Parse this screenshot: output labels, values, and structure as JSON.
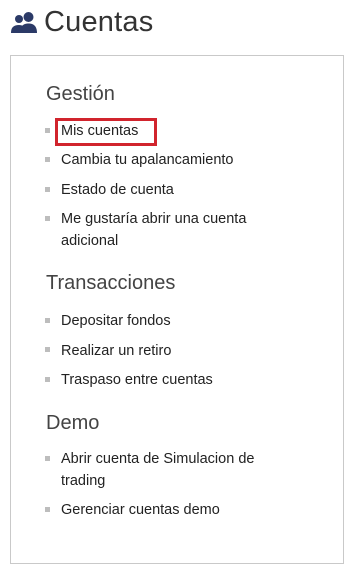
{
  "header": {
    "title": "Cuentas",
    "icon": "users-icon"
  },
  "sections": [
    {
      "title": "Gestión",
      "items": [
        "Mis cuentas",
        "Cambia tu apalancamiento",
        "Estado de cuenta",
        "Me gustaría abrir una cuenta adicional"
      ]
    },
    {
      "title": "Transacciones",
      "items": [
        "Depositar fondos",
        "Realizar un retiro",
        "Traspaso entre cuentas"
      ]
    },
    {
      "title": "Demo",
      "items": [
        "Abrir cuenta de Simulacion de trading",
        "Gerenciar cuentas demo"
      ]
    }
  ],
  "highlight": {
    "item": "Mis cuentas",
    "color": "#d1242d"
  },
  "colors": {
    "text": "#222222",
    "panel_border": "#c9c9c9",
    "bullet": "#bdbdbd"
  }
}
